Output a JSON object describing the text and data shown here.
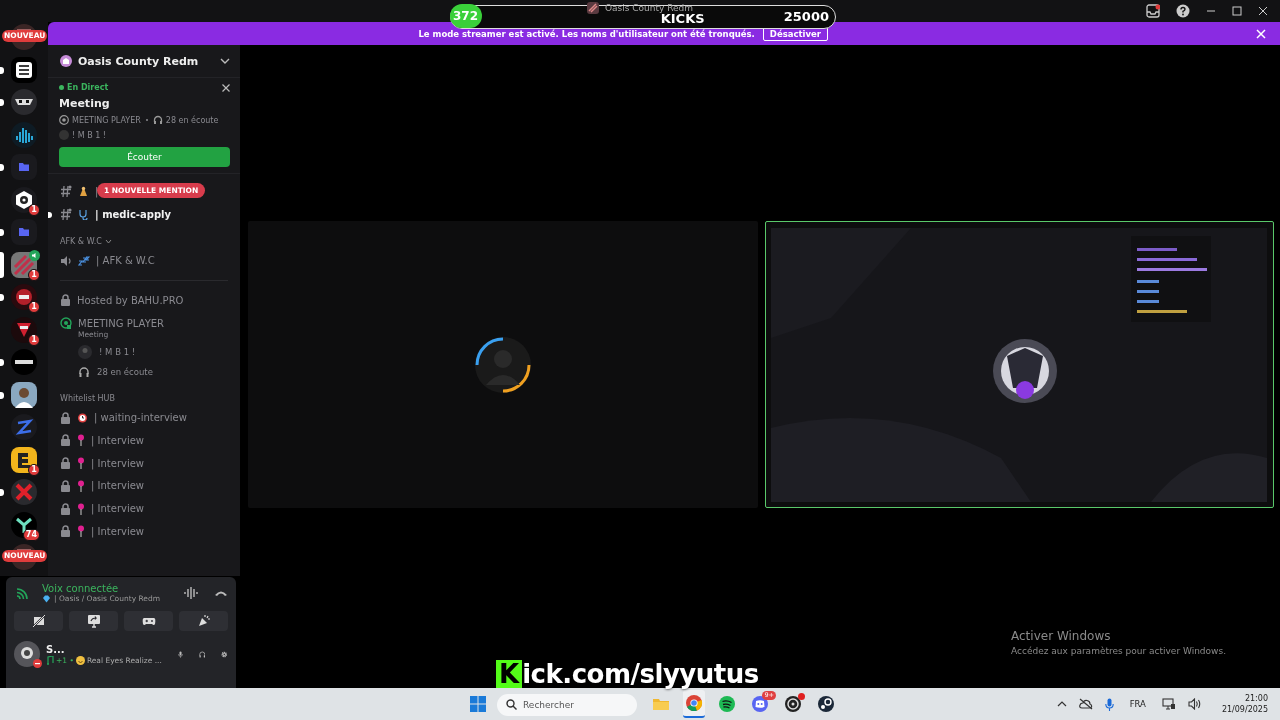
{
  "window": {
    "title": "Oasis County Redm"
  },
  "stream_overlay": {
    "counter": "372",
    "label": "KICKS",
    "goal": "25000",
    "logo_letter": "K",
    "url": "ick.com/slyyutus"
  },
  "banner": {
    "text": "Le mode streamer est activé. Les noms d'utilisateur ont été tronqués.",
    "button": "Désactiver"
  },
  "server_rail": [
    {
      "kind": "avatar",
      "badge": "NOUVEAU",
      "unread": false,
      "selected": false
    },
    {
      "kind": "lines",
      "unread": true,
      "selected": false
    },
    {
      "kind": "mask",
      "unread": true,
      "selected": false
    },
    {
      "kind": "wave",
      "unread": false,
      "selected": false
    },
    {
      "kind": "folder",
      "unread": true,
      "selected": false
    },
    {
      "kind": "hexeye",
      "badge": "1",
      "unread": false,
      "selected": false
    },
    {
      "kind": "folder",
      "unread": true,
      "selected": false
    },
    {
      "kind": "stripes",
      "badge": "1",
      "voice": true,
      "selected": true
    },
    {
      "kind": "redcircle",
      "badge": "1",
      "unread": true,
      "selected": false
    },
    {
      "kind": "redlogo",
      "badge": "1",
      "unread": false,
      "selected": false
    },
    {
      "kind": "screen",
      "unread": true,
      "selected": false
    },
    {
      "kind": "person",
      "unread": true,
      "selected": false
    },
    {
      "kind": "zigzag",
      "unread": false,
      "selected": false
    },
    {
      "kind": "yellow",
      "badge": "1",
      "unread": false,
      "selected": false
    },
    {
      "kind": "redx",
      "unread": true,
      "selected": false
    },
    {
      "kind": "teal",
      "badge": "74",
      "unread": false,
      "selected": false
    },
    {
      "kind": "avatar",
      "badge": "NOUVEAU",
      "unread": false,
      "selected": false
    }
  ],
  "sidebar": {
    "server_name": "Oasis County Redm",
    "stage_card": {
      "status": "En Direct",
      "title": "Meeting",
      "channel": "MEETING PLAYER",
      "listeners": "28 en écoute",
      "speaker": "! M B 1 !",
      "button": "Écouter"
    },
    "items": [
      {
        "kind": "text",
        "emoji": {
          "kind": "figure"
        },
        "name": "|",
        "badge": "1 NOUVELLE MENTION",
        "unread": false
      },
      {
        "kind": "text",
        "emoji": {
          "kind": "stethoscope"
        },
        "name": "| medic-apply",
        "unread": true
      },
      {
        "kind": "category",
        "name": "AFK & W.C",
        "expanded": true
      },
      {
        "kind": "voice",
        "emoji": {
          "kind": "sleep"
        },
        "name": "| AFK & W.C",
        "unread": false
      },
      {
        "kind": "divider"
      },
      {
        "kind": "locked",
        "name": "Hosted by BAHU.PRO",
        "unread": false
      },
      {
        "kind": "stage",
        "name": "MEETING PLAYER",
        "topic": "Meeting",
        "members": [
          "! M B 1 !"
        ],
        "listeners": "28 en écoute"
      },
      {
        "kind": "category",
        "name": "Whitelist HUB",
        "expanded": false
      },
      {
        "kind": "locked",
        "emoji": {
          "kind": "alarm"
        },
        "name": "| waiting-interview",
        "unread": false
      },
      {
        "kind": "locked",
        "emoji": {
          "kind": "pin"
        },
        "name": "| Interview",
        "unread": false
      },
      {
        "kind": "locked",
        "emoji": {
          "kind": "pin"
        },
        "name": "| Interview",
        "unread": false
      },
      {
        "kind": "locked",
        "emoji": {
          "kind": "pin"
        },
        "name": "| Interview",
        "unread": false
      },
      {
        "kind": "locked",
        "emoji": {
          "kind": "pin"
        },
        "name": "| Interview",
        "unread": false
      },
      {
        "kind": "locked",
        "emoji": {
          "kind": "pin"
        },
        "name": "| Interview",
        "unread": false
      }
    ]
  },
  "voice_panel": {
    "status": "Voix connectée",
    "channel": "| Oasis / Oasis County Redm",
    "user": {
      "name": "S...",
      "activity_count": "+1 •",
      "activity": "Real Eyes Realize ..."
    }
  },
  "stage_tiles": [
    {
      "kind": "avatar",
      "speaking": false
    },
    {
      "kind": "picture",
      "speaking": true
    }
  ],
  "activation": {
    "title": "Activer Windows",
    "text": "Accédez aux paramètres pour activer Windows."
  },
  "taskbar": {
    "search": {
      "placeholder": "Rechercher"
    },
    "discord_badge": "9+",
    "language": "FRA",
    "time": "21:00",
    "date": "21/09/2025"
  }
}
